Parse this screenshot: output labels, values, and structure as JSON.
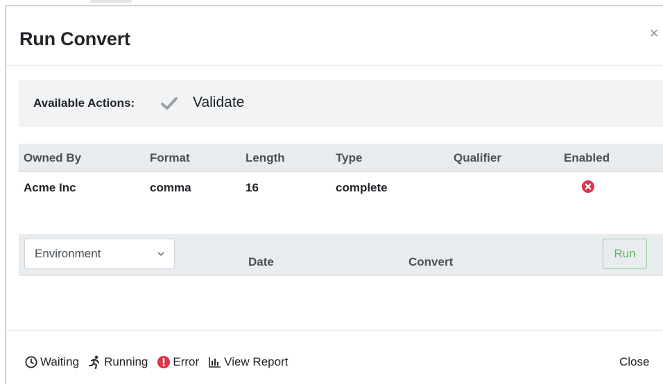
{
  "modal": {
    "title": "Run Convert",
    "close_symbol": "×"
  },
  "actions": {
    "label": "Available Actions:",
    "validate_label": "Validate",
    "icon": "check-icon"
  },
  "table": {
    "headers": [
      "Owned By",
      "Format",
      "Length",
      "Type",
      "Qualifier",
      "Enabled"
    ],
    "rows": [
      {
        "owned_by": "Acme Inc",
        "format": "comma",
        "length": "16",
        "type": "complete",
        "qualifier": "",
        "enabled_icon": "times-circle-icon",
        "enabled_color": "#dc3545"
      }
    ]
  },
  "run_panel": {
    "environment_placeholder": "Environment",
    "date_label": "Date",
    "convert_label": "Convert",
    "run_label": "Run",
    "run_color": "#5cb85c"
  },
  "footer": {
    "legend": [
      {
        "icon": "clock-icon",
        "label": "Waiting"
      },
      {
        "icon": "running-icon",
        "label": "Running"
      },
      {
        "icon": "exclamation-circle-icon",
        "label": "Error",
        "color": "#dc3545"
      },
      {
        "icon": "bar-chart-icon",
        "label": "View Report"
      }
    ],
    "close_label": "Close"
  }
}
